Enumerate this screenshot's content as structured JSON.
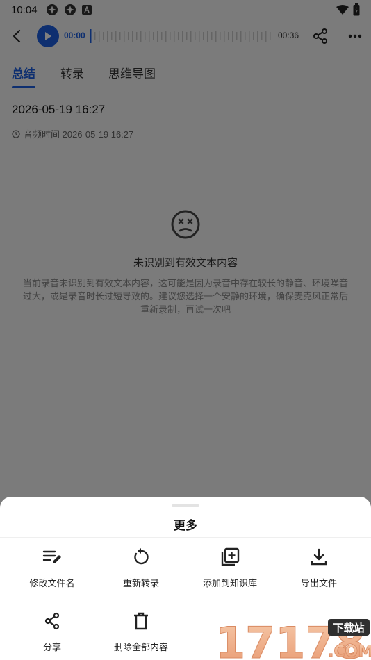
{
  "status_bar": {
    "time": "10:04"
  },
  "player": {
    "time_start": "00:00",
    "time_end": "00:36"
  },
  "tabs": [
    {
      "label": "总结"
    },
    {
      "label": "转录"
    },
    {
      "label": "思维导图"
    }
  ],
  "record": {
    "title": "2026-05-19 16:27",
    "audio_time": "音频时间 2026-05-19 16:27"
  },
  "empty_state": {
    "title": "未识别到有效文本内容",
    "description": "当前录音未识别到有效文本内容，这可能是因为录音中存在较长的静音、环境噪音过大，或是录音时长过短导致的。建议您选择一个安静的环境，确保麦克风正常后重新录制，再试一次吧"
  },
  "sheet": {
    "title": "更多",
    "actions": [
      {
        "label": "修改文件名",
        "icon": "edit-list-icon"
      },
      {
        "label": "重新转录",
        "icon": "refresh-icon"
      },
      {
        "label": "添加到知识库",
        "icon": "add-library-icon"
      },
      {
        "label": "导出文件",
        "icon": "download-icon"
      },
      {
        "label": "分享",
        "icon": "share-icon"
      },
      {
        "label": "删除全部内容",
        "icon": "trash-icon"
      }
    ]
  },
  "watermark": {
    "number": "17178",
    "tag": "下载站",
    "domain": ".COM"
  },
  "colors": {
    "accent": "#1d5fe0",
    "overlay": "rgba(0,0,0,0.5)"
  }
}
